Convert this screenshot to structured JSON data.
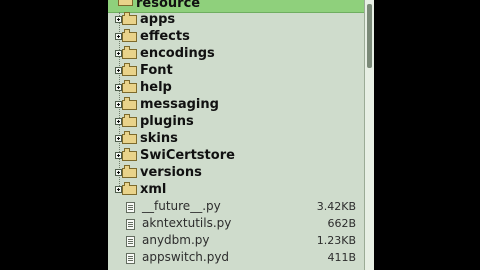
{
  "tree": {
    "root_label": "resource",
    "folders": [
      {
        "label": "apps"
      },
      {
        "label": "effects"
      },
      {
        "label": "encodings"
      },
      {
        "label": "Font"
      },
      {
        "label": "help"
      },
      {
        "label": "messaging"
      },
      {
        "label": "plugins"
      },
      {
        "label": "skins"
      },
      {
        "label": "SwiCertstore"
      },
      {
        "label": "versions"
      },
      {
        "label": "xml"
      }
    ],
    "files": [
      {
        "name": "__future__.py",
        "size": "3.42KB"
      },
      {
        "name": "akntextutils.py",
        "size": "662B"
      },
      {
        "name": "anydbm.py",
        "size": "1.23KB"
      },
      {
        "name": "appswitch.pyd",
        "size": "411B"
      }
    ]
  }
}
